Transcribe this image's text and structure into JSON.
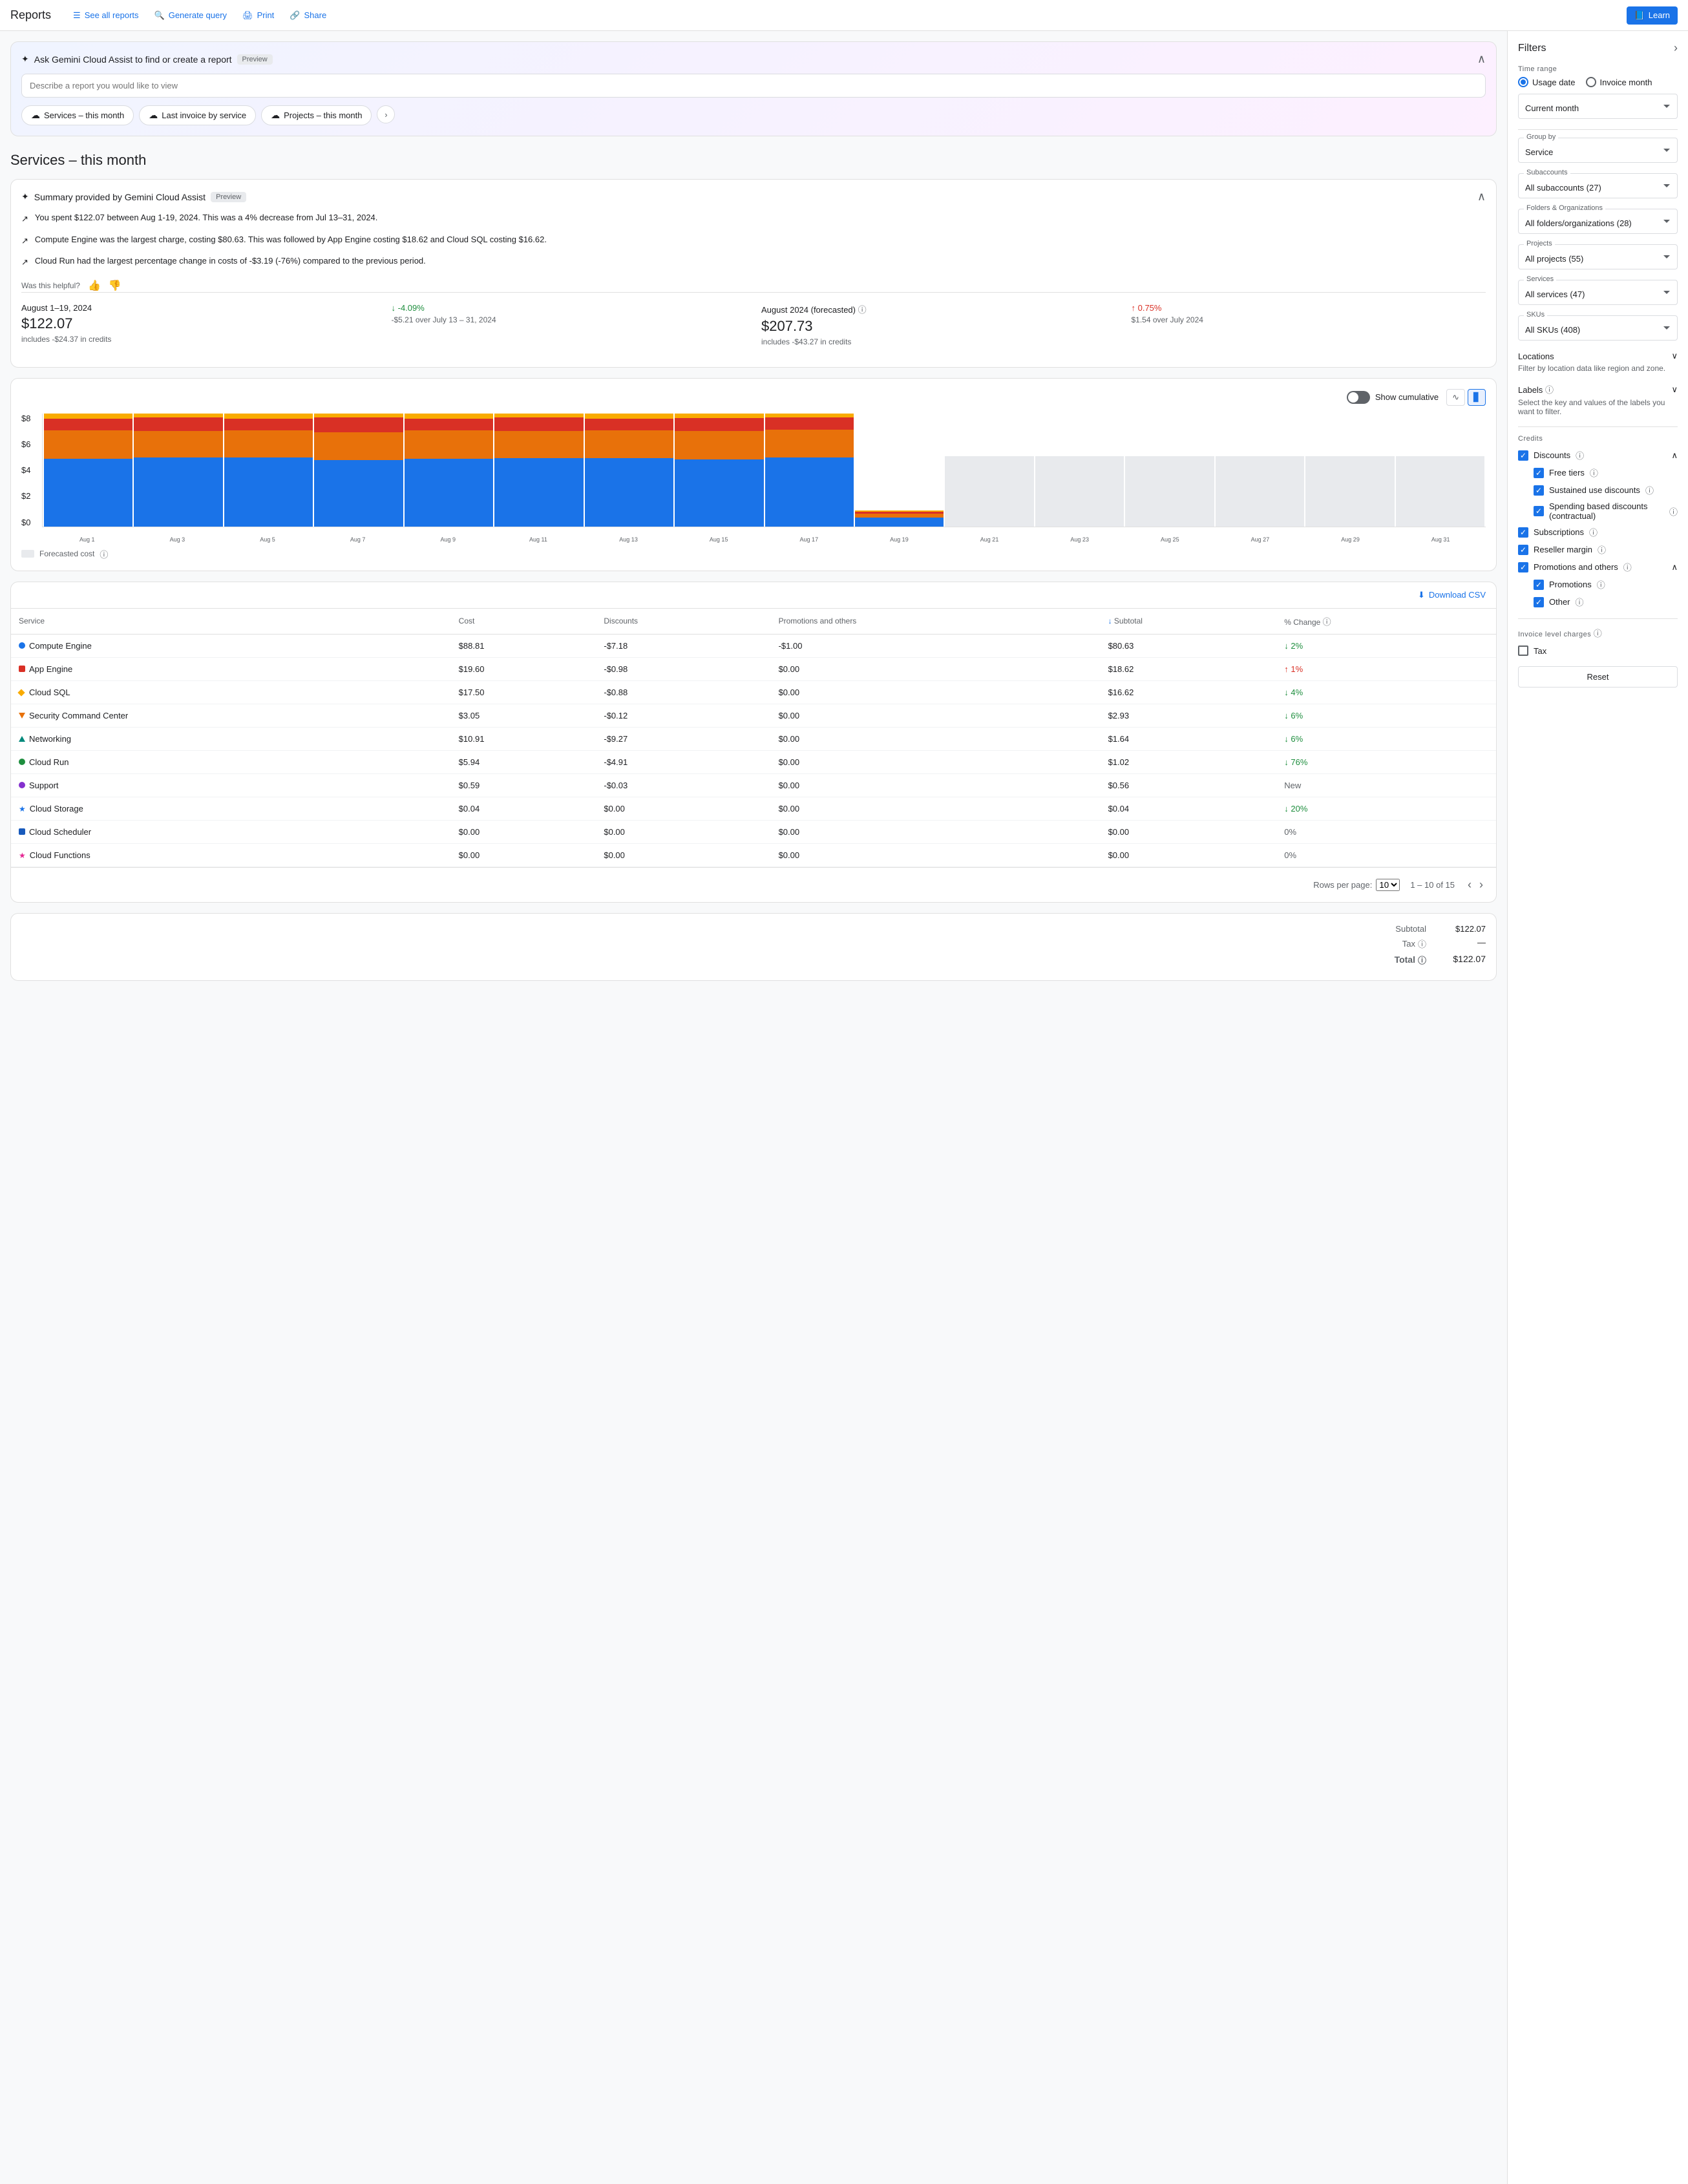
{
  "header": {
    "title": "Reports",
    "nav": [
      {
        "id": "see-all",
        "label": "See all reports",
        "icon": "list"
      },
      {
        "id": "generate",
        "label": "Generate query",
        "icon": "search"
      },
      {
        "id": "print",
        "label": "Print",
        "icon": "print"
      },
      {
        "id": "share",
        "label": "Share",
        "icon": "share"
      }
    ],
    "learn_label": "Learn"
  },
  "gemini": {
    "title": "Ask Gemini Cloud Assist to find or create a report",
    "preview_badge": "Preview",
    "input_placeholder": "Describe a report you would like to view",
    "chips": [
      {
        "id": "services",
        "label": "Services – this month"
      },
      {
        "id": "last-invoice",
        "label": "Last invoice by service"
      },
      {
        "id": "projects",
        "label": "Projects – this month"
      }
    ]
  },
  "page_title": "Services – this month",
  "summary": {
    "title": "Summary provided by Gemini Cloud Assist",
    "preview_badge": "Preview",
    "bullets": [
      "You spent $122.07 between Aug 1-19, 2024. This was a 4% decrease from Jul 13–31, 2024.",
      "Compute Engine was the largest charge, costing $80.63. This was followed by App Engine costing $18.62 and Cloud SQL costing $16.62.",
      "Cloud Run had the largest percentage change in costs of -$3.19 (-76%) compared to the previous period."
    ],
    "helpful_label": "Was this helpful?"
  },
  "metrics": {
    "current": {
      "period": "August 1–19, 2024",
      "amount": "$122.07",
      "sub": "includes -$24.37 in credits",
      "change": "↓ -4.09%",
      "change_type": "down",
      "change_sub": "-$5.21 over July 13 – 31, 2024"
    },
    "forecasted": {
      "period": "August 2024 (forecasted)",
      "amount": "$207.73",
      "sub": "includes -$43.27 in credits",
      "change": "↑ 0.75%",
      "change_type": "up",
      "change_sub": "$1.54 over July 2024"
    }
  },
  "chart": {
    "cumulative_label": "Show cumulative",
    "y_labels": [
      "$8",
      "$6",
      "$4",
      "$2",
      "$0"
    ],
    "x_labels": [
      "Aug 1",
      "Aug 3",
      "Aug 5",
      "Aug 7",
      "Aug 9",
      "Aug 11",
      "Aug 13",
      "Aug 15",
      "Aug 17",
      "Aug 19",
      "Aug 21",
      "Aug 23",
      "Aug 25",
      "Aug 27",
      "Aug 29",
      "Aug 31"
    ],
    "forecast_legend": "Forecasted cost",
    "bars": [
      {
        "blue": 60,
        "orange": 25,
        "red": 10,
        "yellow": 5,
        "forecasted": 0
      },
      {
        "blue": 62,
        "orange": 24,
        "red": 12,
        "yellow": 4,
        "forecasted": 0
      },
      {
        "blue": 65,
        "orange": 26,
        "red": 11,
        "yellow": 5,
        "forecasted": 0
      },
      {
        "blue": 60,
        "orange": 25,
        "red": 13,
        "yellow": 4,
        "forecasted": 0
      },
      {
        "blue": 63,
        "orange": 27,
        "red": 11,
        "yellow": 5,
        "forecasted": 0
      },
      {
        "blue": 62,
        "orange": 25,
        "red": 12,
        "yellow": 4,
        "forecasted": 0
      },
      {
        "blue": 64,
        "orange": 26,
        "red": 11,
        "yellow": 5,
        "forecasted": 0
      },
      {
        "blue": 65,
        "orange": 28,
        "red": 12,
        "yellow": 5,
        "forecasted": 0
      },
      {
        "blue": 64,
        "orange": 26,
        "red": 11,
        "yellow": 4,
        "forecasted": 0
      },
      {
        "blue": 8,
        "orange": 3,
        "red": 2,
        "yellow": 1,
        "forecasted": 0
      },
      {
        "blue": 0,
        "orange": 0,
        "red": 0,
        "yellow": 0,
        "forecasted": 62
      },
      {
        "blue": 0,
        "orange": 0,
        "red": 0,
        "yellow": 0,
        "forecasted": 62
      },
      {
        "blue": 0,
        "orange": 0,
        "red": 0,
        "yellow": 0,
        "forecasted": 62
      },
      {
        "blue": 0,
        "orange": 0,
        "red": 0,
        "yellow": 0,
        "forecasted": 62
      },
      {
        "blue": 0,
        "orange": 0,
        "red": 0,
        "yellow": 0,
        "forecasted": 62
      },
      {
        "blue": 0,
        "orange": 0,
        "red": 0,
        "yellow": 0,
        "forecasted": 62
      }
    ]
  },
  "table": {
    "download_label": "Download CSV",
    "columns": [
      "Service",
      "Cost",
      "Discounts",
      "Promotions and others",
      "Subtotal",
      "% Change"
    ],
    "rows": [
      {
        "service": "Compute Engine",
        "dot": "blue",
        "shape": "circle",
        "cost": "$88.81",
        "discounts": "-$7.18",
        "promotions": "-$1.00",
        "subtotal": "$80.63",
        "change": "↓ 2%",
        "change_type": "down"
      },
      {
        "service": "App Engine",
        "dot": "red",
        "shape": "square",
        "cost": "$19.60",
        "discounts": "-$0.98",
        "promotions": "$0.00",
        "subtotal": "$18.62",
        "change": "↑ 1%",
        "change_type": "up"
      },
      {
        "service": "Cloud SQL",
        "dot": "yellow",
        "shape": "diamond",
        "cost": "$17.50",
        "discounts": "-$0.88",
        "promotions": "$0.00",
        "subtotal": "$16.62",
        "change": "↓ 4%",
        "change_type": "down"
      },
      {
        "service": "Security Command Center",
        "dot": "orange",
        "shape": "triangle-down",
        "cost": "$3.05",
        "discounts": "-$0.12",
        "promotions": "$0.00",
        "subtotal": "$2.93",
        "change": "↓ 6%",
        "change_type": "down"
      },
      {
        "service": "Networking",
        "dot": "teal",
        "shape": "triangle-up",
        "cost": "$10.91",
        "discounts": "-$9.27",
        "promotions": "$0.00",
        "subtotal": "$1.64",
        "change": "↓ 6%",
        "change_type": "down"
      },
      {
        "service": "Cloud Run",
        "dot": "green",
        "shape": "circle",
        "cost": "$5.94",
        "discounts": "-$4.91",
        "promotions": "$0.00",
        "subtotal": "$1.02",
        "change": "↓ 76%",
        "change_type": "down"
      },
      {
        "service": "Support",
        "dot": "purple",
        "shape": "circle",
        "cost": "$0.59",
        "discounts": "-$0.03",
        "promotions": "$0.00",
        "subtotal": "$0.56",
        "change": "New",
        "change_type": "neutral"
      },
      {
        "service": "Cloud Storage",
        "dot": "blue",
        "shape": "star",
        "cost": "$0.04",
        "discounts": "$0.00",
        "promotions": "$0.00",
        "subtotal": "$0.04",
        "change": "↓ 20%",
        "change_type": "down"
      },
      {
        "service": "Cloud Scheduler",
        "dot": "darkblue",
        "shape": "square",
        "cost": "$0.00",
        "discounts": "$0.00",
        "promotions": "$0.00",
        "subtotal": "$0.00",
        "change": "0%",
        "change_type": "neutral"
      },
      {
        "service": "Cloud Functions",
        "dot": "pink",
        "shape": "star",
        "cost": "$0.00",
        "discounts": "$0.00",
        "promotions": "$0.00",
        "subtotal": "$0.00",
        "change": "0%",
        "change_type": "neutral"
      }
    ],
    "pagination": {
      "rows_per_page": "10",
      "range": "1 – 10 of 15"
    }
  },
  "totals": {
    "subtotal_label": "Subtotal",
    "subtotal_value": "$122.07",
    "tax_label": "Tax",
    "tax_value": "—",
    "total_label": "Total",
    "total_value": "$122.07"
  },
  "filters": {
    "title": "Filters",
    "time_range": {
      "label": "Time range",
      "options": [
        "Usage date",
        "Invoice month"
      ],
      "selected": "Usage date",
      "period_label": "Current month"
    },
    "group_by": {
      "label": "Group by",
      "selected": "Service"
    },
    "subaccounts": {
      "label": "Subaccounts",
      "selected": "All subaccounts (27)"
    },
    "folders": {
      "label": "Folders & Organizations",
      "selected": "All folders/organizations (28)"
    },
    "projects": {
      "label": "Projects",
      "selected": "All projects (55)"
    },
    "services": {
      "label": "Services",
      "selected": "All services (47)"
    },
    "skus": {
      "label": "SKUs",
      "selected": "All SKUs (408)"
    },
    "locations": {
      "label": "Locations",
      "sub": "Filter by location data like region and zone."
    },
    "labels": {
      "label": "Labels",
      "sub": "Select the key and values of the labels you want to filter."
    },
    "credits": {
      "label": "Credits",
      "sections": [
        {
          "label": "Discounts",
          "expanded": true,
          "children": [
            "Free tiers",
            "Sustained use discounts",
            "Spending based discounts (contractual)"
          ]
        },
        {
          "label": "Subscriptions",
          "expanded": false,
          "children": []
        },
        {
          "label": "Reseller margin",
          "expanded": false,
          "children": []
        },
        {
          "label": "Promotions and others",
          "expanded": true,
          "children": [
            "Promotions",
            "Other"
          ]
        }
      ]
    },
    "invoice_charges": {
      "label": "Invoice level charges",
      "items": [
        "Tax"
      ]
    },
    "reset_label": "Reset"
  }
}
